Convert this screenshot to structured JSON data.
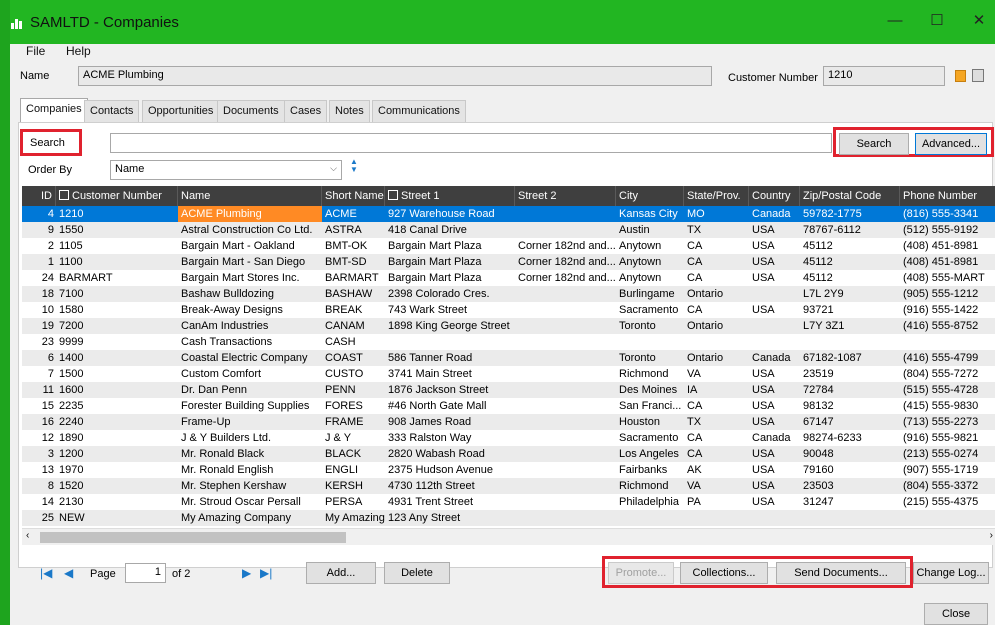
{
  "window": {
    "title": "SAMLTD - Companies",
    "minimize": "—",
    "maximize": "☐",
    "close": "✕"
  },
  "menu": {
    "file": "File",
    "help": "Help"
  },
  "header": {
    "name_label": "Name",
    "name_value": "ACME Plumbing",
    "customer_number_label": "Customer Number",
    "customer_number_value": "1210"
  },
  "tabs": [
    "Companies",
    "Contacts",
    "Opportunities",
    "Documents",
    "Cases",
    "Notes",
    "Communications"
  ],
  "search": {
    "label": "Search",
    "value": "",
    "search_button": "Search",
    "advanced_button": "Advanced..."
  },
  "order_by": {
    "label": "Order By",
    "value": "Name"
  },
  "columns": [
    "ID",
    "Customer Number",
    "Name",
    "Short Name",
    "Street 1",
    "Street 2",
    "City",
    "State/Prov.",
    "Country",
    "Zip/Postal Code",
    "Phone Number"
  ],
  "rows": [
    [
      "4",
      "1210",
      "ACME Plumbing",
      "ACME",
      "927 Warehouse Road",
      "",
      "Kansas City",
      "MO",
      "Canada",
      "59782-1775",
      "(816) 555-3341"
    ],
    [
      "9",
      "1550",
      "Astral Construction Co Ltd.",
      "ASTRA",
      "418 Canal Drive",
      "",
      "Austin",
      "TX",
      "USA",
      "78767-6112",
      "(512) 555-9192"
    ],
    [
      "2",
      "1105",
      "Bargain Mart - Oakland",
      "BMT-OK",
      "Bargain Mart Plaza",
      "Corner 182nd and...",
      "Anytown",
      "CA",
      "USA",
      "45112",
      "(408) 451-8981"
    ],
    [
      "1",
      "1100",
      "Bargain Mart - San Diego",
      "BMT-SD",
      "Bargain Mart Plaza",
      "Corner 182nd and...",
      "Anytown",
      "CA",
      "USA",
      "45112",
      "(408) 451-8981"
    ],
    [
      "24",
      "BARMART",
      "Bargain Mart Stores Inc.",
      "BARMART",
      "Bargain Mart Plaza",
      "Corner 182nd and...",
      "Anytown",
      "CA",
      "USA",
      "45112",
      "(408) 555-MART"
    ],
    [
      "18",
      "7100",
      "Bashaw Bulldozing",
      "BASHAW",
      "2398 Colorado Cres.",
      "",
      "Burlingame",
      "Ontario",
      "",
      "L7L 2Y9",
      "(905) 555-1212"
    ],
    [
      "10",
      "1580",
      "Break-Away Designs",
      "BREAK",
      "743 Wark Street",
      "",
      "Sacramento",
      "CA",
      "USA",
      "93721",
      "(916) 555-1422"
    ],
    [
      "19",
      "7200",
      "CanAm Industries",
      "CANAM",
      "1898 King George Street",
      "",
      "Toronto",
      "Ontario",
      "",
      "L7Y 3Z1",
      "(416) 555-8752"
    ],
    [
      "23",
      "9999",
      "Cash Transactions",
      "CASH",
      "",
      "",
      "",
      "",
      "",
      "",
      ""
    ],
    [
      "6",
      "1400",
      "Coastal Electric Company",
      "COAST",
      "586 Tanner Road",
      "",
      "Toronto",
      "Ontario",
      "Canada",
      "67182-1087",
      "(416) 555-4799"
    ],
    [
      "7",
      "1500",
      "Custom Comfort",
      "CUSTO",
      "3741 Main Street",
      "",
      "Richmond",
      "VA",
      "USA",
      "23519",
      "(804) 555-7272"
    ],
    [
      "11",
      "1600",
      "Dr. Dan Penn",
      "PENN",
      "1876 Jackson Street",
      "",
      "Des Moines",
      "IA",
      "USA",
      "72784",
      "(515) 555-4728"
    ],
    [
      "15",
      "2235",
      "Forester Building Supplies",
      "FORES",
      "#46 North Gate Mall",
      "",
      "San Franci...",
      "CA",
      "USA",
      "98132",
      "(415) 555-9830"
    ],
    [
      "16",
      "2240",
      "Frame-Up",
      "FRAME",
      "908 James Road",
      "",
      "Houston",
      "TX",
      "USA",
      "67147",
      "(713) 555-2273"
    ],
    [
      "12",
      "1890",
      "J & Y Builders Ltd.",
      "J & Y",
      "333 Ralston Way",
      "",
      "Sacramento",
      "CA",
      "Canada",
      "98274-6233",
      "(916) 555-9821"
    ],
    [
      "3",
      "1200",
      "Mr. Ronald Black",
      "BLACK",
      "2820 Wabash Road",
      "",
      "Los Angeles",
      "CA",
      "USA",
      "90048",
      "(213) 555-0274"
    ],
    [
      "13",
      "1970",
      "Mr. Ronald English",
      "ENGLI",
      "2375 Hudson Avenue",
      "",
      "Fairbanks",
      "AK",
      "USA",
      "79160",
      "(907) 555-1719"
    ],
    [
      "8",
      "1520",
      "Mr. Stephen Kershaw",
      "KERSH",
      "4730 112th Street",
      "",
      "Richmond",
      "VA",
      "USA",
      "23503",
      "(804) 555-3372"
    ],
    [
      "14",
      "2130",
      "Mr. Stroud Oscar Persall",
      "PERSA",
      "4931 Trent Street",
      "",
      "Philadelphia",
      "PA",
      "USA",
      "31247",
      "(215) 555-4375"
    ],
    [
      "25",
      "NEW",
      "My Amazing Company",
      "My Amazing",
      "123 Any Street",
      "",
      "",
      "",
      "",
      "",
      ""
    ]
  ],
  "pager": {
    "page_label": "Page",
    "page_value": "1",
    "of_label": "of 2"
  },
  "buttons": {
    "add": "Add...",
    "delete": "Delete",
    "promote": "Promote...",
    "collections": "Collections...",
    "send_documents": "Send Documents...",
    "change_log": "Change Log...",
    "close": "Close"
  },
  "colors": {
    "title_bar": "#22b622",
    "grid_header": "#3f3f3f",
    "selection": "#0078d7",
    "highlight": "#ff8a24",
    "callout": "#e0222e"
  }
}
